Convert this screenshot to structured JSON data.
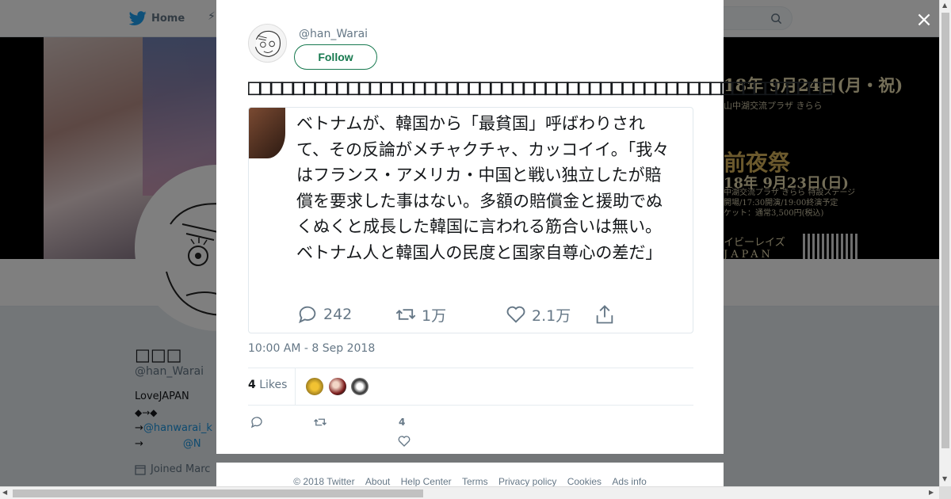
{
  "background": {
    "nav": {
      "home_label": "Home"
    },
    "banner": {
      "line1": "18年 9月24日(月・祝)",
      "line2": "山中湖交流プラザ きらら",
      "line3": "前夜祭",
      "line4": "18年 9月23日(日)",
      "line5a": "中湖交流プラザ きらら 特設ステージ",
      "line5b": "開場/17:30開演/19:00終演予定",
      "line5c": "ケット：通常3,500円(税込)",
      "line6": "イビーレイズ",
      "line7": "JAPAN"
    },
    "profile": {
      "name": "□□□",
      "handle": "@han_Warai",
      "bio_line1": "LoveJAPAN",
      "bio_line2": "◆→◆",
      "bio_line3_prefix": "→",
      "bio_line3_link": "@hanwarai_k",
      "bio_line4_prefix": "→",
      "bio_line4_link": "@N",
      "joined": "Joined Marc"
    }
  },
  "modal": {
    "author_handle": "@han_Warai",
    "follow_label": "Follow",
    "tweet_text": "□□□□□□□□□□□□□□□□□□□□□□□□□□□□□□□□□□□□□□□□□□□□□□□□□□□□□",
    "quote": {
      "text": "ベトナムが、韓国から「最貧国」呼ばわりされて、その反論がメチャクチャ、カッコイイ。「我々はフランス・アメリカ・中国と戦い独立したが賠償を要求した事はない。多額の賠償金と援助でぬくぬくと成長した韓国に言われる筋合いは無い。ベトナム人と韓国人の民度と国家自尊心の差だ」",
      "replies": "242",
      "retweets": "1万",
      "likes": "2.1万"
    },
    "timestamp": "10:00 AM - 8 Sep 2018",
    "likes_count": "4",
    "likes_label": "Likes",
    "action_like_count": "4"
  },
  "footer": {
    "copyright": "© 2018 Twitter",
    "about": "About",
    "help": "Help Center",
    "terms": "Terms",
    "privacy": "Privacy policy",
    "cookies": "Cookies",
    "ads": "Ads info"
  },
  "close_label": "×",
  "colors": {
    "brand": "#1da1f2",
    "follow": "#17794f",
    "link": "#1b95e0",
    "muted": "#657786"
  },
  "icons": [
    "twitter-bird-icon",
    "search-icon",
    "close-icon",
    "reply-icon",
    "retweet-icon",
    "heart-icon",
    "share-icon",
    "calendar-icon"
  ]
}
